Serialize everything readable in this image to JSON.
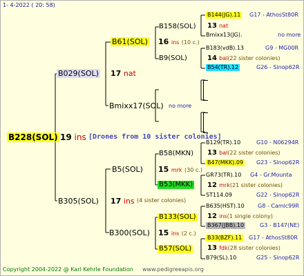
{
  "header": {
    "date": "1-   4-2022 ( 20: 58)"
  },
  "root": {
    "name": "B228(SOL)",
    "num": "19",
    "ins": "ins",
    "note": "[Drones from 10 sister colonies]"
  },
  "g1": [
    {
      "name": "B029(SOL)",
      "num": "17",
      "ins": "nat",
      "note": ""
    },
    {
      "name": "B305(SOL)",
      "num": "17",
      "ins": "ins",
      "note": "(4 sister colonies)"
    }
  ],
  "g2": [
    {
      "name": "B61(SOL)",
      "num": "16",
      "ins": "ins",
      "note": "(10 c.)"
    },
    {
      "name": "Bmixx17(SOL)",
      "num": "",
      "ins": "",
      "note": "no more"
    },
    {
      "name": "B5(SOL)",
      "num": "15",
      "ins": "mrk",
      "note": "(30 c.)"
    },
    {
      "name": "B300(SOL)",
      "num": "15",
      "ins": "ins",
      "note": "(2 c.)"
    }
  ],
  "g3": [
    {
      "name": "B158(SOL)"
    },
    {
      "name": "B9(SOL)"
    },
    {
      "name": "B58(MKN)"
    },
    {
      "name": "B53(MKK)"
    },
    {
      "name": "B133(SOL)"
    },
    {
      "name": "B57(SOL)"
    }
  ],
  "g4": [
    {
      "name": "B144(JG).11",
      "code": "G17 - AthosSt80R"
    },
    {
      "name": "13",
      "ins": "nat"
    },
    {
      "name": "Bmixx13(JG).",
      "code": "no more"
    },
    {
      "name": "B183(vdB).13",
      "code": "G9 - MG00R"
    },
    {
      "name": "14",
      "ins": "bal",
      "note": "(22 sister colonies)"
    },
    {
      "name": "B54(TR).12",
      "code": "G26 - Sinop62R"
    },
    {
      "name": "B129(TR).10",
      "code": "G10 - N06294R"
    },
    {
      "name": "13",
      "ins": "bal",
      "note": "(22 sister colonies)"
    },
    {
      "name": "B47(MKK).09",
      "code": "G23 - Sinop62R"
    },
    {
      "name": "GR73(TR).10",
      "code": "G4 - Gr.Mounta"
    },
    {
      "name": "12",
      "ins": "mrk",
      "note": "(21 sister colonies)"
    },
    {
      "name": "ST114.09",
      "code": "G22 - Sinop62R"
    },
    {
      "name": "B635(HST).10",
      "code": "G8 - Camic99R"
    },
    {
      "name": "12",
      "ins": "ins",
      "note": "(1 single colony)"
    },
    {
      "name": "B367(JBB).10",
      "code": "G3 - B147(NE)"
    },
    {
      "name": "B33(BZF).11",
      "code": "G17 - AthosSt80R"
    },
    {
      "name": "13",
      "ins": "fdk",
      "note": "(28 sister colonies)"
    },
    {
      "name": "B79(SL).10",
      "code": "G25 - Sinop62R"
    }
  ],
  "footer": {
    "copyright": "Copyright 2004-2022 @ Karl Kehrle Foundation",
    "url": "www.pedigreeapis.org"
  },
  "colors": {
    "background": "#ffffe0",
    "yellow": "#ffff22",
    "cyan": "#22ddff",
    "green": "#22dd22",
    "gray": "#b8b8b8"
  }
}
